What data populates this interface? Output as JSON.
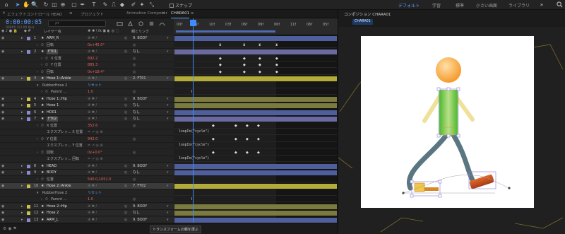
{
  "toolbar": {
    "snap_label": "スナップ",
    "workspaces": [
      "デフォルト",
      "学習",
      "標準",
      "小さい画面",
      "ライブラリ"
    ],
    "selected_workspace": "デフォルト"
  },
  "timeline_tabs": {
    "tab1": "エフェクトコントロール HEAD",
    "tab2": "プロジェクト",
    "tab3": "Animation Composer",
    "tab4": "CHARA01"
  },
  "header": {
    "timecode": "0:00:00:05",
    "frame_info": "00005 (12.00 fps)",
    "search_placeholder": "ρ▾"
  },
  "columns": {
    "layer_name": "レイヤー名",
    "parent_link": "親とリンク"
  },
  "ruler": {
    "ticks": [
      "00f",
      "06f",
      "10f",
      "03f",
      "06f",
      "09f",
      "06f",
      "11f",
      "06f",
      "05f"
    ]
  },
  "rows": [
    {
      "t": "layer",
      "num": "1",
      "name": "ARM_R",
      "parent": "9. BODY",
      "color": "#8a8ad0"
    },
    {
      "t": "prop",
      "ind": 1,
      "name": "回転",
      "val": "0x+45.0°"
    },
    {
      "t": "layer",
      "num": "2",
      "name": "FT01",
      "parent": "なし",
      "color": "#8a8ad0",
      "boxed": true
    },
    {
      "t": "prop",
      "ind": 2,
      "name": "X 位置",
      "val": "692.2"
    },
    {
      "t": "prop",
      "ind": 2,
      "name": "Y 位置",
      "val": "885.3"
    },
    {
      "t": "prop",
      "ind": 1,
      "name": "回転",
      "val": "0x+18.4°"
    },
    {
      "t": "layer",
      "num": "3",
      "name": "Hose 1::Ankle",
      "parent": "2. FT01",
      "color": "#c8c04a",
      "hl": true
    },
    {
      "t": "group",
      "name": "RubberHose 2",
      "val": "リセット"
    },
    {
      "t": "prop",
      "ind": 2,
      "name": "Parent ...",
      "val": "1.0"
    },
    {
      "t": "layer",
      "num": "4",
      "name": "Hose 1::Hip",
      "parent": "9. BODY",
      "color": "#c8c04a"
    },
    {
      "t": "layer",
      "num": "5",
      "name": "Hose 1",
      "parent": "なし",
      "color": "#c8c04a"
    },
    {
      "t": "layer",
      "num": "6",
      "name": "HD01",
      "parent": "なし",
      "color": "#8a8ad0"
    },
    {
      "t": "layer",
      "num": "7",
      "name": "FT02",
      "parent": "なし",
      "color": "#8a8ad0",
      "boxed": true
    },
    {
      "t": "prop",
      "ind": 1,
      "name": "X 位置",
      "val": "352.6"
    },
    {
      "t": "expr",
      "ind": 2,
      "name": "エクスプレッ... X 位置"
    },
    {
      "t": "prop",
      "ind": 1,
      "name": "Y 位置",
      "val": "942.0"
    },
    {
      "t": "expr",
      "ind": 2,
      "name": "エクスプレッ... Y 位置"
    },
    {
      "t": "prop",
      "ind": 1,
      "name": "回転",
      "val": "0x+0.0°"
    },
    {
      "t": "expr",
      "ind": 2,
      "name": "エクスプレッ... 回転"
    },
    {
      "t": "layer",
      "num": "8",
      "name": "HEAD",
      "parent": "9. BODY",
      "color": "#8a8ad0"
    },
    {
      "t": "layer",
      "num": "9",
      "name": "BODY",
      "parent": "なし",
      "color": "#8a8ad0"
    },
    {
      "t": "prop",
      "ind": 1,
      "name": "位置",
      "val": "540.0,1052.0"
    },
    {
      "t": "layer",
      "num": "10",
      "name": "Hose 2::Ankle",
      "parent": "7. FT02",
      "color": "#c8c04a",
      "hl": true
    },
    {
      "t": "group",
      "name": "RubberHose 2",
      "val": "リセット"
    },
    {
      "t": "prop",
      "ind": 2,
      "name": "Parent ...",
      "val": "1.0"
    },
    {
      "t": "layer",
      "num": "11",
      "name": "Hose 2::Hip",
      "parent": "9. BODY",
      "color": "#c8c04a"
    },
    {
      "t": "layer",
      "num": "12",
      "name": "Hose 2",
      "parent": "なし",
      "color": "#c8c04a"
    },
    {
      "t": "layer",
      "num": "13",
      "name": "ARM_L",
      "parent": "9. BODY",
      "color": "#8a8ad0"
    },
    {
      "t": "prop",
      "ind": 1,
      "name": "回転",
      "val": "0x-45.0°"
    },
    {
      "t": "layer",
      "num": "14",
      "name": "BG_WHT",
      "parent": "なし",
      "color": "#8a8ad0"
    }
  ],
  "expressions": {
    "loop": "loopIn(\"cycle\")"
  },
  "status": {
    "tooltip": "トランスフォームの親を選ぶ"
  },
  "comp": {
    "tab": "コンポジション CHARA01",
    "sub": "CHARA01"
  },
  "colors": {
    "accent": "#3e8bff",
    "value_red": "#e3635b"
  }
}
